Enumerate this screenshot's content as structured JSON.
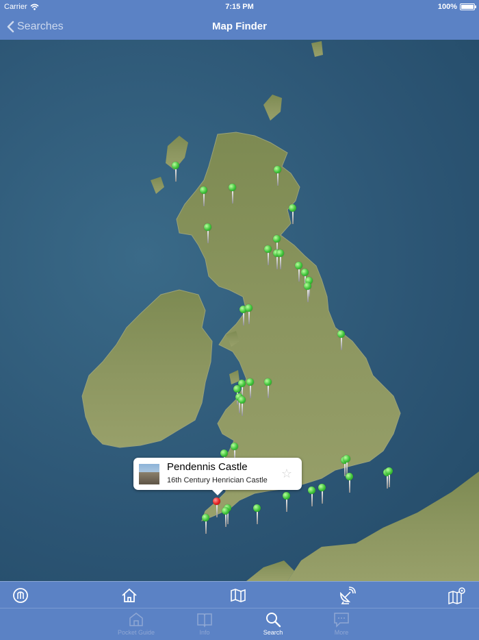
{
  "status_bar": {
    "carrier": "Carrier",
    "time": "7:15 PM",
    "battery": "100%"
  },
  "nav": {
    "back_label": "Searches",
    "title": "Map Finder"
  },
  "callout": {
    "title": "Pendennis Castle",
    "subtitle": "16th Century Henrician Castle"
  },
  "toolbar": {
    "items": [
      "guide-icon",
      "home-icon",
      "map-icon",
      "satellite-dish-icon",
      "map-settings-icon"
    ]
  },
  "tabs": [
    {
      "label": "Pocket Guide",
      "icon": "castle-icon"
    },
    {
      "label": "Info",
      "icon": "book-icon"
    },
    {
      "label": "Search",
      "icon": "search-icon",
      "active": true
    },
    {
      "label": "More",
      "icon": "chat-bubble-icon"
    }
  ],
  "colors": {
    "bar": "#5b82c5",
    "pin_green": "#3fc33a",
    "pin_red": "#e52020"
  }
}
